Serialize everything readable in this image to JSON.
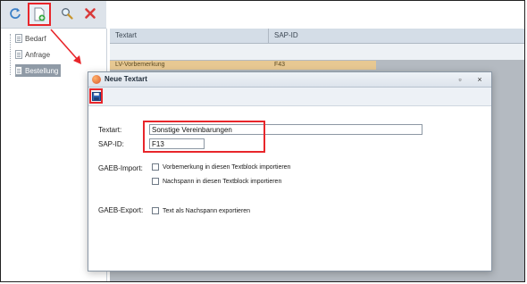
{
  "tree": {
    "items": [
      {
        "label": "Bedarf"
      },
      {
        "label": "Anfrage"
      },
      {
        "label": "Bestellung"
      }
    ]
  },
  "grid": {
    "columns": [
      "Textart",
      "SAP-ID"
    ],
    "row": {
      "textart": "LV-Vorbemerkung",
      "sap_id": "F43"
    }
  },
  "dialog": {
    "title": "Neue Textart",
    "minimize": "▫",
    "close": "×",
    "fields": {
      "textart_label": "Textart:",
      "textart_value": "Sonstige Vereinbarungen",
      "sapid_label": "SAP-ID:",
      "sapid_value": "F13",
      "gaeb_import_label": "GAEB-Import:",
      "import_opt1": "Vorbemerkung in diesen Textblock importieren",
      "import_opt2": "Nachspann in diesen Textblock importieren",
      "gaeb_export_label": "GAEB-Export:",
      "export_opt1": "Text als Nachspann exportieren"
    }
  },
  "colors": {
    "highlight": "#e8262b",
    "selected_row": "#e7c892",
    "grid_bg": "#b4bac1"
  },
  "icons": {
    "toolbar": [
      "refresh-icon",
      "new-document-icon",
      "search-icon",
      "delete-icon"
    ],
    "dialog": [
      "save-icon"
    ]
  }
}
